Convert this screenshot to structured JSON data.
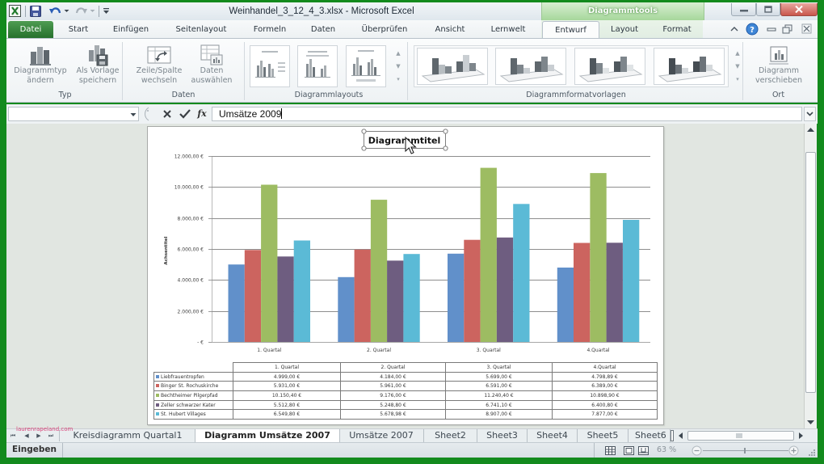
{
  "window": {
    "title": "Weinhandel_3_12_4_3.xlsx - Microsoft Excel",
    "context_tab_group": "Diagrammtools"
  },
  "quick_access_toolbar": {
    "items": [
      "excel-app-icon",
      "save-icon",
      "undo-icon",
      "redo-icon",
      "customize-toolbar-icon"
    ]
  },
  "window_controls": [
    "minimize-icon",
    "restore-icon",
    "close-icon"
  ],
  "tabs": [
    {
      "label": "Datei",
      "type": "file"
    },
    {
      "label": "Start"
    },
    {
      "label": "Einfügen"
    },
    {
      "label": "Seitenlayout"
    },
    {
      "label": "Formeln"
    },
    {
      "label": "Daten"
    },
    {
      "label": "Überprüfen"
    },
    {
      "label": "Ansicht"
    },
    {
      "label": "Lernwelt"
    },
    {
      "label": "Entwurf",
      "selected": true,
      "context": true
    },
    {
      "label": "Layout",
      "context": true
    },
    {
      "label": "Format",
      "context": true
    }
  ],
  "tabrow_right_icons": [
    "minimize-ribbon-icon",
    "help-icon",
    "doc-minimize-icon",
    "doc-restore-icon",
    "doc-close-icon"
  ],
  "ribbon": {
    "groups": [
      {
        "label": "Typ",
        "buttons": [
          {
            "line1": "Diagrammtyp",
            "line2": "ändern",
            "icon": "change-chart-type-icon"
          },
          {
            "line1": "Als Vorlage",
            "line2": "speichern",
            "icon": "save-as-template-icon"
          }
        ]
      },
      {
        "label": "Daten",
        "buttons": [
          {
            "line1": "Zeile/Spalte",
            "line2": "wechseln",
            "icon": "switch-row-column-icon"
          },
          {
            "line1": "Daten",
            "line2": "auswählen",
            "icon": "select-data-icon"
          }
        ]
      },
      {
        "label": "Diagrammlayouts",
        "visible_gallery_items": 3
      },
      {
        "label": "Diagrammformatvorlagen",
        "visible_gallery_items": 4
      },
      {
        "label": "Ort",
        "buttons": [
          {
            "line1": "Diagramm",
            "line2": "verschieben",
            "icon": "move-chart-icon"
          }
        ]
      }
    ]
  },
  "formula_bar": {
    "name_box": "",
    "function_label": "fx",
    "value": "Umsätze 2009"
  },
  "chart_data": {
    "type": "bar",
    "title": "Diagrammtitel",
    "xlabel": "",
    "ylabel": "Achsentitel",
    "categories": [
      "1. Quartal",
      "2. Quartal",
      "3. Quartal",
      "4.Quartal"
    ],
    "series": [
      {
        "name": "Liebfrauentropfen",
        "color": "#6190ca",
        "values": [
          4999.0,
          4184.0,
          5699.0,
          4798.89
        ]
      },
      {
        "name": "Binger St. Rochuskirche",
        "color": "#cc645f",
        "values": [
          5931.0,
          5961.0,
          6591.0,
          6389.0
        ]
      },
      {
        "name": "Bechtheimer Pilgerpfad",
        "color": "#9dbc62",
        "values": [
          10150.4,
          9176.0,
          11240.4,
          10898.9
        ]
      },
      {
        "name": "Zeller schwarzer Kater",
        "color": "#6e5d80",
        "values": [
          5512.8,
          5248.8,
          6741.1,
          6400.8
        ]
      },
      {
        "name": "St. Hubert Villages",
        "color": "#5bbad6",
        "values": [
          6549.8,
          5678.98,
          8907.0,
          7877.0
        ]
      }
    ],
    "ylim": [
      0,
      12000
    ],
    "yticks": [
      0,
      2000,
      4000,
      6000,
      8000,
      10000,
      12000
    ],
    "ytick_labels": [
      "-  €",
      "2.000,00 €",
      "4.000,00 €",
      "6.000,00 €",
      "8.000,00 €",
      "10.000,00 €",
      "12.000,00 €"
    ],
    "grid": true,
    "legend": "data-table",
    "data_table": {
      "header": [
        "1. Quartal",
        "2. Quartal",
        "3. Quartal",
        "4.Quartal"
      ],
      "rows": [
        [
          "4.999,00 €",
          "4.184,00 €",
          "5.699,00 €",
          "4.798,89 €"
        ],
        [
          "5.931,00 €",
          "5.961,00 €",
          "6.591,00 €",
          "6.389,00 €"
        ],
        [
          "10.150,40 €",
          "9.176,00 €",
          "11.240,40 €",
          "10.898,90 €"
        ],
        [
          "5.512,80 €",
          "5.248,80 €",
          "6.741,10 €",
          "6.400,80 €"
        ],
        [
          "6.549,80 €",
          "5.678,98 €",
          "8.907,00 €",
          "7.877,00 €"
        ]
      ]
    }
  },
  "sheet_tabs": [
    {
      "label": "Kreisdiagramm Quartal1"
    },
    {
      "label": "Diagramm Umsätze 2007",
      "active": true
    },
    {
      "label": "Umsätze 2007"
    },
    {
      "label": "Sheet2"
    },
    {
      "label": "Sheet3"
    },
    {
      "label": "Sheet4"
    },
    {
      "label": "Sheet5"
    },
    {
      "label": "Sheet6"
    }
  ],
  "status_bar": {
    "mode": "Eingeben",
    "zoom": "63 %",
    "zoom_percent": 63
  },
  "watermark": "laurenrapeland.com"
}
